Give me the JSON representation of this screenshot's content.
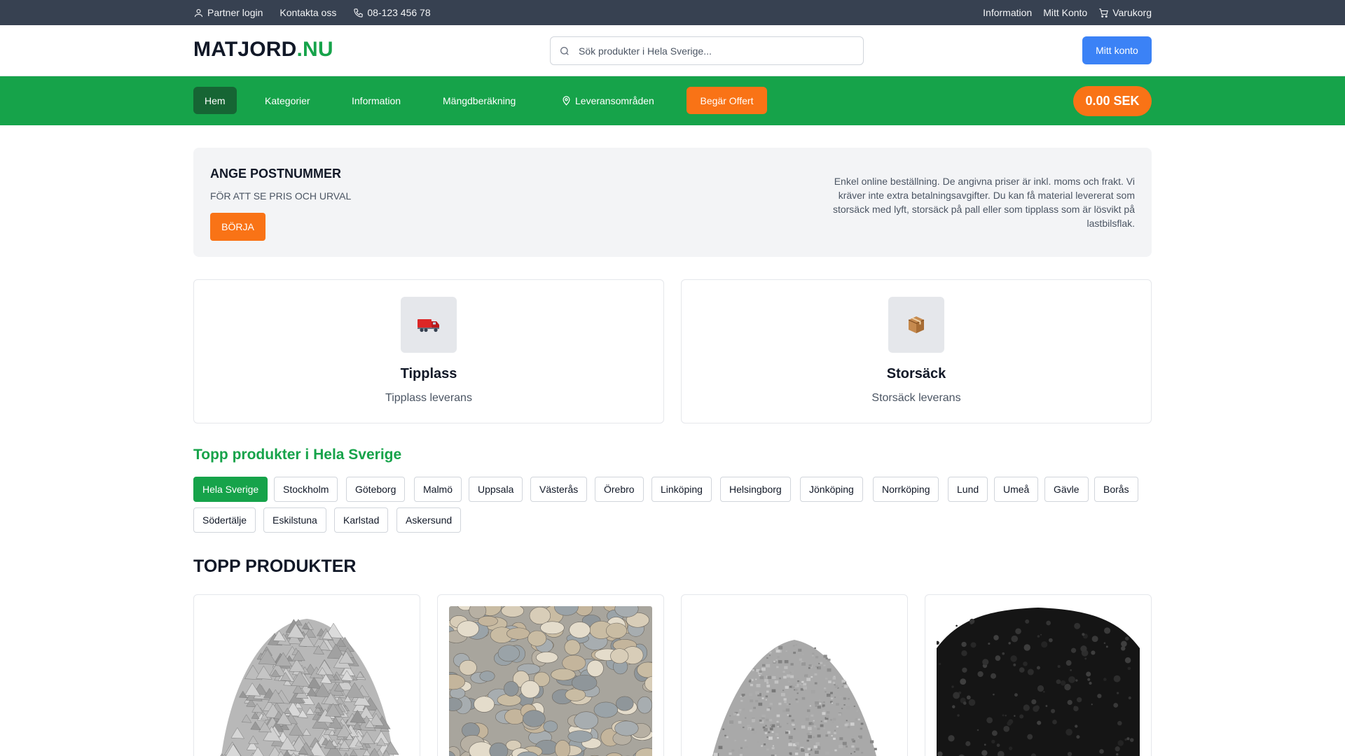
{
  "topbar": {
    "partner_login": "Partner login",
    "contact": "Kontakta oss",
    "phone": "08-123 456 78",
    "information": "Information",
    "my_account": "Mitt Konto",
    "cart": "Varukorg"
  },
  "header": {
    "logo_main": "MATJORD",
    "logo_tld": ".NU",
    "search_placeholder": "Sök produkter i Hela Sverige...",
    "account_button": "Mitt konto"
  },
  "nav": {
    "items": [
      {
        "label": "Hem",
        "active": true
      },
      {
        "label": "Kategorier"
      },
      {
        "label": "Information"
      },
      {
        "label": "Mängdberäkning"
      },
      {
        "label": "Leveransområden",
        "icon": "map-pin-icon"
      }
    ],
    "offert_button": "Begär Offert",
    "cart_total": "0.00 SEK"
  },
  "postcode": {
    "title": "ANGE POSTNUMMER",
    "subtitle": "FÖR ATT SE PRIS OCH URVAL",
    "button": "BÖRJA",
    "info": "Enkel online beställning. De angivna priser är inkl. moms och frakt. Vi kräver inte extra betalningsavgifter. Du kan få material levererat som storsäck med lyft, storsäck på pall eller som tipplass som är lösvikt på lastbilsflak."
  },
  "delivery": [
    {
      "icon": "truck-icon",
      "emoji": "🚛",
      "title": "Tipplass",
      "desc": "Tipplass leverans"
    },
    {
      "icon": "package-icon",
      "emoji": "📦",
      "title": "Storsäck",
      "desc": "Storsäck leverans"
    }
  ],
  "regions": {
    "title": "Topp produkter i Hela Sverige",
    "active": "Hela Sverige",
    "items": [
      "Hela Sverige",
      "Stockholm",
      "Göteborg",
      "Malmö",
      "Uppsala",
      "Västerås",
      "Örebro",
      "Linköping",
      "Helsingborg",
      "Jönköping",
      "Norrköping",
      "Lund",
      "Umeå",
      "Gävle",
      "Borås",
      "Södertälje",
      "Eskilstuna",
      "Karlstad",
      "Askersund"
    ]
  },
  "products": {
    "title": "TOPP PRODUKTER",
    "items": [
      {
        "image": "grey-gravel"
      },
      {
        "image": "river-pebbles"
      },
      {
        "image": "fine-grey-gravel"
      },
      {
        "image": "black-soil"
      }
    ]
  },
  "colors": {
    "topbar": "#374151",
    "brand_green": "#16a34a",
    "nav_active": "#166534",
    "accent_orange": "#f97316",
    "button_blue": "#3b82f6"
  }
}
